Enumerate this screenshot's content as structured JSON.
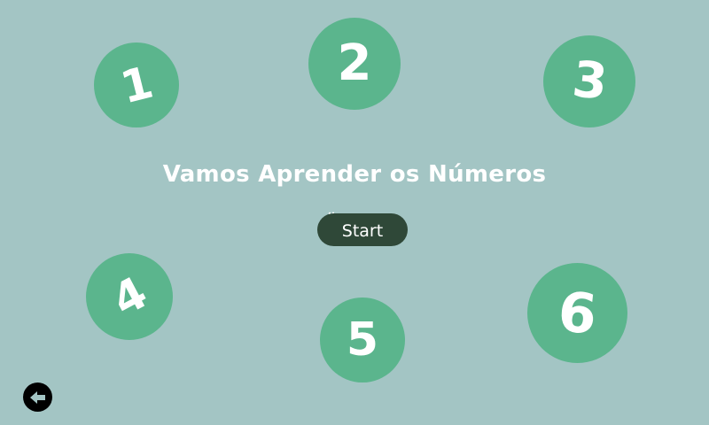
{
  "title": "Vamos Aprender os Números",
  "start_button": {
    "label": "Start"
  },
  "numbers": [
    "1",
    "2",
    "3",
    "4",
    "5",
    "6"
  ],
  "back_button": {
    "icon": "arrow-left-icon"
  },
  "colors": {
    "background": "#a3c5c4",
    "circle": "#5bb58d",
    "start_button": "#2f4838",
    "text": "#ffffff",
    "back_button": "#000000"
  }
}
